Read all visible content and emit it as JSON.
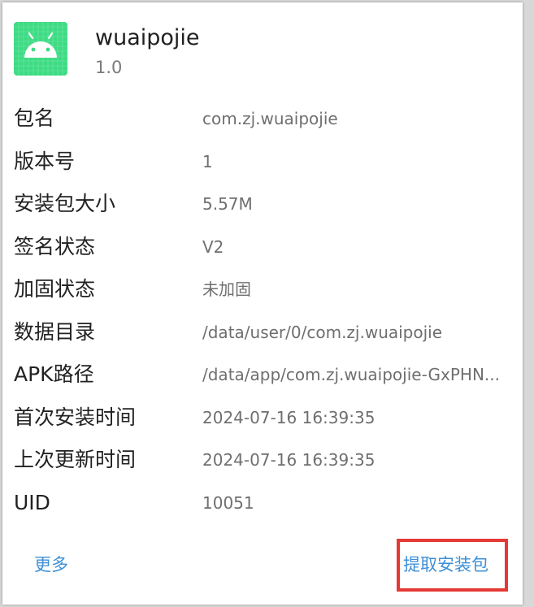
{
  "app": {
    "name": "wuaipojie",
    "version": "1.0",
    "icon": "android-robot-icon",
    "icon_bg_color": "#3ddc84"
  },
  "info_rows": [
    {
      "label": "包名",
      "value": "com.zj.wuaipojie"
    },
    {
      "label": "版本号",
      "value": "1"
    },
    {
      "label": "安装包大小",
      "value": "5.57M"
    },
    {
      "label": "签名状态",
      "value": "V2"
    },
    {
      "label": "加固状态",
      "value": "未加固"
    },
    {
      "label": "数据目录",
      "value": "/data/user/0/com.zj.wuaipojie"
    },
    {
      "label": "APK路径",
      "value": "/data/app/com.zj.wuaipojie-GxPHN..."
    },
    {
      "label": "首次安装时间",
      "value": "2024-07-16 16:39:35"
    },
    {
      "label": "上次更新时间",
      "value": "2024-07-16 16:39:35"
    },
    {
      "label": "UID",
      "value": "10051"
    }
  ],
  "actions": {
    "more_label": "更多",
    "extract_label": "提取安装包",
    "accent_color": "#3d8fd6",
    "highlight_color": "#e53935"
  }
}
